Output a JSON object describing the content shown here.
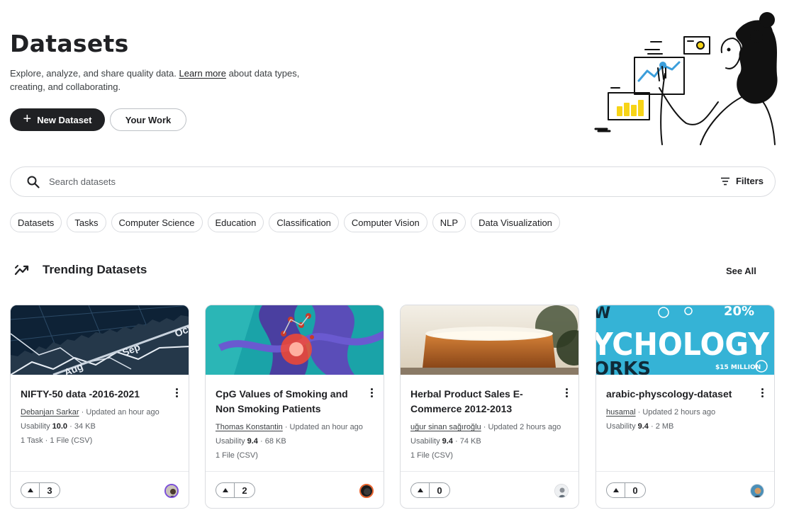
{
  "header": {
    "title": "Datasets",
    "subtitle_before": "Explore, analyze, and share quality data. ",
    "learn_more": "Learn more",
    "subtitle_after": " about data types, creating, and collaborating.",
    "new_dataset": "New Dataset",
    "your_work": "Your Work"
  },
  "search": {
    "placeholder": "Search datasets",
    "filters_label": "Filters"
  },
  "chips": [
    "Datasets",
    "Tasks",
    "Computer Science",
    "Education",
    "Classification",
    "Computer Vision",
    "NLP",
    "Data Visualization"
  ],
  "trending": {
    "title": "Trending Datasets",
    "see_all": "See All"
  },
  "cards": [
    {
      "title": "NIFTY-50 data -2016-2021",
      "owner": "Debanjan Sarkar",
      "updated": " · Updated an hour ago",
      "usability_label": "Usability ",
      "usability": "10.0",
      "size": " · 34 KB",
      "files": "1 Task · 1 File (CSV)",
      "votes": "3"
    },
    {
      "title": "CpG Values of Smoking and Non Smoking Patients",
      "owner": "Thomas Konstantin",
      "updated": " · Updated an hour ago",
      "usability_label": "Usability ",
      "usability": "9.4",
      "size": " · 68 KB",
      "files": "1 File (CSV)",
      "votes": "2"
    },
    {
      "title": "Herbal Product Sales E-Commerce 2012-2013",
      "owner": "uğur sinan sağıroğlu",
      "updated": " · Updated 2 hours ago",
      "usability_label": "Usability ",
      "usability": "9.4",
      "size": " · 74 KB",
      "files": "1 File (CSV)",
      "votes": "0"
    },
    {
      "title": "arabic-physcology-dataset",
      "owner": "husamal",
      "updated": " · Updated 2 hours ago",
      "usability_label": "Usability ",
      "usability": "9.4",
      "size": " · 2 MB",
      "files": "",
      "votes": "0"
    }
  ],
  "thumb_text": {
    "nifty_months": [
      "Sep",
      "Aug",
      "Oct"
    ],
    "psych_word": "YCHOLOGY",
    "psych_top": "W",
    "psych_pct": "20%",
    "psych_works": "ORKS",
    "psych_money": "$15 MILLION"
  },
  "colors": {
    "primary": "#202124",
    "border": "#dadce0",
    "muted": "#5f6368",
    "psych_bg": "#35b3d6"
  }
}
